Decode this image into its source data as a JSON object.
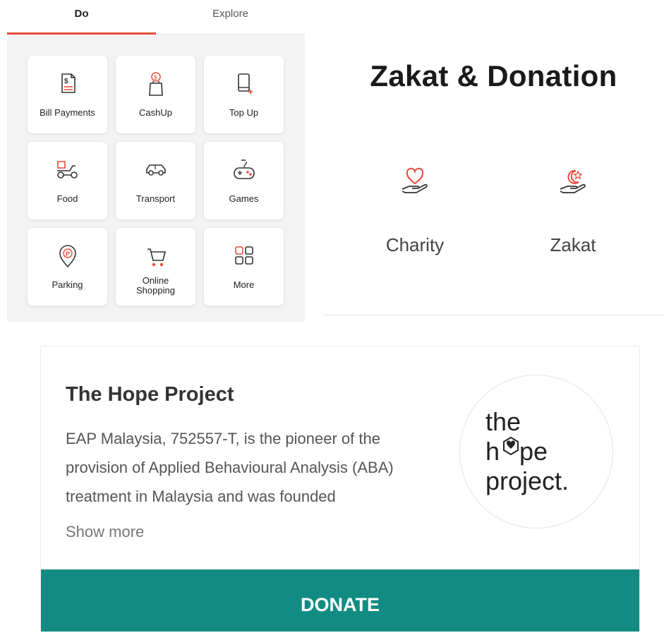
{
  "tabs": [
    {
      "label": "Do",
      "active": true
    },
    {
      "label": "Explore",
      "active": false
    }
  ],
  "services": [
    {
      "label": "Bill Payments",
      "icon": "bill-icon"
    },
    {
      "label": "CashUp",
      "icon": "cashup-bag-icon"
    },
    {
      "label": "Top Up",
      "icon": "topup-phone-icon"
    },
    {
      "label": "Food",
      "icon": "food-scooter-icon"
    },
    {
      "label": "Transport",
      "icon": "car-icon"
    },
    {
      "label": "Games",
      "icon": "gamepad-icon"
    },
    {
      "label": "Parking",
      "icon": "parking-pin-icon"
    },
    {
      "label": "Online\nShopping",
      "icon": "shopping-cart-icon"
    },
    {
      "label": "More",
      "icon": "more-grid-icon"
    }
  ],
  "donation": {
    "title": "Zakat & Donation",
    "categories": [
      {
        "label": "Charity",
        "icon": "charity-heart-hand-icon"
      },
      {
        "label": "Zakat",
        "icon": "zakat-moon-hand-icon"
      }
    ]
  },
  "project": {
    "title": "The Hope Project",
    "description": "EAP Malaysia, 752557-T, is the pioneer of the provision of Applied Behavioural Analysis (ABA) treatment in Malaysia and was founded",
    "show_more": "Show more",
    "logo_lines": [
      "the",
      "hope",
      "project."
    ],
    "donate_label": "DONATE"
  },
  "colors": {
    "accent_red": "#e74c3c",
    "donate_teal": "#128c83"
  }
}
